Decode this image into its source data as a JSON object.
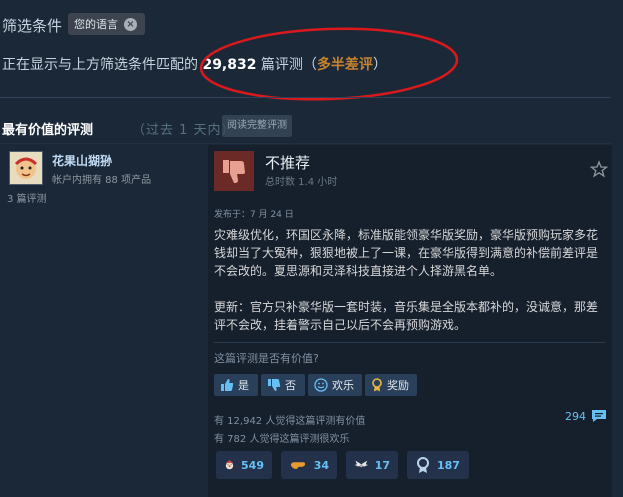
{
  "filter": {
    "label": "筛选条件",
    "chip_label": "您的语言",
    "chip_close": "×"
  },
  "summary": {
    "prefix": "正在显示与上方筛选条件匹配的 ",
    "count": "29,832",
    "middle": " 篇评测（",
    "score": "多半差评",
    "suffix": "）"
  },
  "section": {
    "title": "最有价值的评测",
    "subtitle": "（过去 1 天内）",
    "read_all": "阅读完整评测"
  },
  "author": {
    "name": "花果山猢狲",
    "products": "帐户内拥有 88 项产品",
    "reviews": "3 篇评测"
  },
  "review": {
    "verdict": "不推荐",
    "hours": "总时数 1.4 小时",
    "posted": "发布于：7 月 24 日",
    "paragraph1": "灾难级优化，环国区永降，标准版能领豪华版奖励，豪华版预购玩家多花钱却当了大冤种，狠狠地被上了一课，在豪华版得到满意的补偿前差评是不会改的。夏思源和灵泽科技直接进个人择游黑名单。",
    "paragraph2": "更新：官方只补豪华版一套时装，音乐集是全版本都补的，没诚意，那差评不会改，挂着警示自己以后不会再预购游戏。"
  },
  "helpful": {
    "question": "这篇评测是否有价值?",
    "yes": "是",
    "no": "否",
    "funny": "欢乐",
    "award": "奖励",
    "stat_helpful": "有 12,942 人觉得这篇评测有价值",
    "stat_funny": "有 782 人觉得这篇评测很欢乐",
    "comments": "294"
  },
  "awards": [
    {
      "icon": "clown-icon",
      "count": "549"
    },
    {
      "icon": "hand-icon",
      "count": "34"
    },
    {
      "icon": "wings-icon",
      "count": "17"
    },
    {
      "icon": "medal-icon",
      "count": "187"
    }
  ],
  "colors": {
    "background": "#1b2838",
    "accent": "#66c0f4",
    "negative_score": "#c5822f",
    "annotation_circle": "#d9191c"
  }
}
